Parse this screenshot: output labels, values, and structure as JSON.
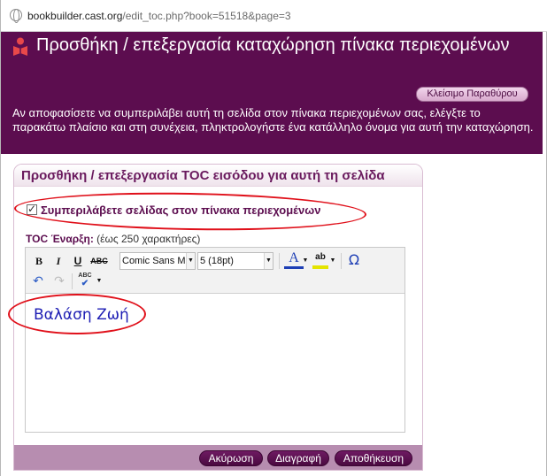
{
  "browser": {
    "url_domain": "bookbuilder.cast.org",
    "url_path": "/edit_toc.php?book=51518&page=3"
  },
  "header": {
    "title": "Προσθήκη / επεξεργασία καταχώρηση πίνακα περιεχομένων",
    "close_label": "Κλείσιμο Παραθύρου",
    "intro": "Αν αποφασίσετε να συμπεριλάβει αυτή τη σελίδα στον πίνακα περιεχομένων σας, ελέγξτε το παρακάτω πλαίσιο και στη συνέχεια, πληκτρολογήστε ένα κατάλληλο όνομα για αυτή την καταχώρηση."
  },
  "panel": {
    "title": "Προσθήκη / επεξεργασία TOC εισόδου για αυτή τη σελίδα",
    "checkbox_label": "Συμπεριλάβετε σελίδας στον πίνακα περιεχομένων",
    "checkbox_checked": true,
    "toc_label": "TOC Έναρξη:",
    "toc_hint": "(έως 250 χαρακτήρες)"
  },
  "editor": {
    "font_family": "Comic Sans MS",
    "font_size": "5 (18pt)",
    "content": "Βαλάση Ζωή",
    "icons": [
      "bold-icon",
      "italic-icon",
      "underline-icon",
      "strikethrough-icon",
      "font-color-icon",
      "highlight-icon",
      "special-char-icon",
      "undo-icon",
      "redo-icon",
      "spellcheck-icon"
    ]
  },
  "footer": {
    "cancel_label": "Ακύρωση",
    "delete_label": "Διαγραφή",
    "save_label": "Αποθήκευση"
  },
  "colors": {
    "header_bg": "#5c0d4f",
    "accent": "#6a1a5e",
    "footer_bg": "#b78db0",
    "annotation": "#e0101a"
  }
}
